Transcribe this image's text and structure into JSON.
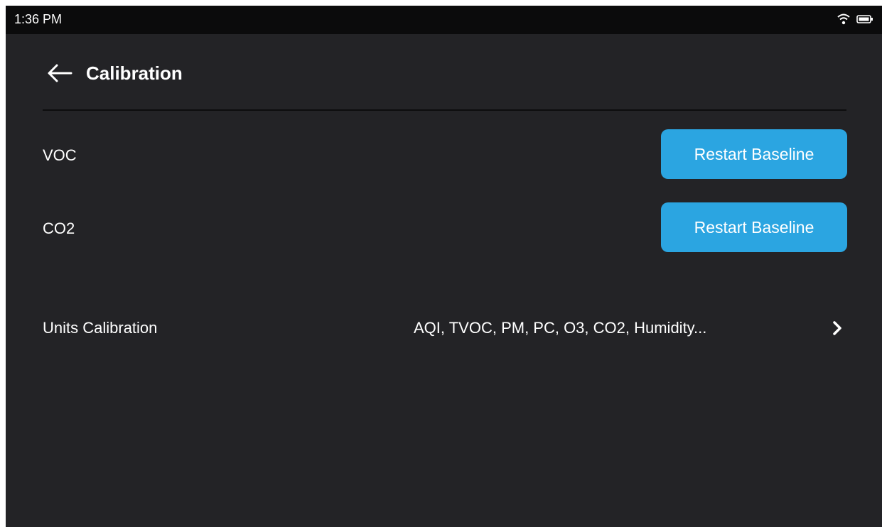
{
  "status_bar": {
    "time": "1:36 PM",
    "icons": [
      "wifi-icon",
      "battery-icon"
    ]
  },
  "header": {
    "back_icon": "arrow-left-icon",
    "title": "Calibration"
  },
  "calibration_rows": [
    {
      "label": "VOC",
      "button_label": "Restart Baseline"
    },
    {
      "label": "CO2",
      "button_label": "Restart Baseline"
    }
  ],
  "units_calibration": {
    "label": "Units Calibration",
    "value": "AQI, TVOC, PM, PC, O3, CO2, Humidity...",
    "icon": "chevron-right-icon"
  },
  "colors": {
    "background": "#232326",
    "status_bar": "#0b0b0c",
    "accent": "#2ba5e1",
    "text": "#ffffff"
  }
}
